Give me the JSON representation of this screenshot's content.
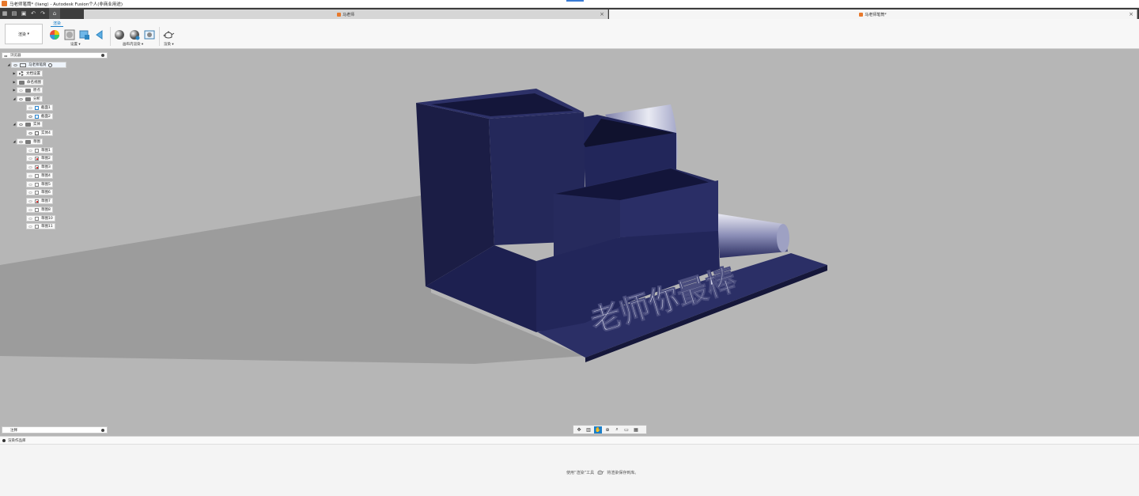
{
  "window": {
    "title": "马老师笔筒* (liang) - Autodesk Fusion个人(非商业用途)"
  },
  "tabs": [
    {
      "label": "马老师"
    },
    {
      "label": "马老师笔筒*"
    }
  ],
  "ribbon": {
    "workspace_label": "渲染",
    "tab_label": "渲染",
    "groups": {
      "setup": "设置",
      "incanvas": "画布内渲染",
      "render": "渲染"
    }
  },
  "browser": {
    "title": "浏览器",
    "root": "马老师笔筒",
    "items": [
      {
        "label": "文档设置",
        "depth": 1
      },
      {
        "label": "命名视图",
        "depth": 1
      },
      {
        "label": "原点",
        "depth": 1
      },
      {
        "label": "分析",
        "depth": 1
      },
      {
        "label": "截面1",
        "depth": 2
      },
      {
        "label": "截面2",
        "depth": 2
      },
      {
        "label": "实体",
        "depth": 1
      },
      {
        "label": "实体4",
        "depth": 2
      },
      {
        "label": "草图",
        "depth": 1
      },
      {
        "label": "草图1",
        "depth": 2
      },
      {
        "label": "草图2",
        "depth": 2
      },
      {
        "label": "草图3",
        "depth": 2
      },
      {
        "label": "草图4",
        "depth": 2
      },
      {
        "label": "草图5",
        "depth": 2
      },
      {
        "label": "草图6",
        "depth": 2
      },
      {
        "label": "草图7",
        "depth": 2
      },
      {
        "label": "草图8",
        "depth": 2
      },
      {
        "label": "草图10",
        "depth": 2
      },
      {
        "label": "草图11",
        "depth": 2
      }
    ]
  },
  "model": {
    "engraved_text": "老师你最棒"
  },
  "comments": {
    "title": "注释"
  },
  "gallery": {
    "title": "渲染作品库",
    "hint_before": "使用“渲染”工具",
    "hint_after": "将渲染保存到库。"
  },
  "colors": {
    "viewport": "#b6b6b6",
    "model": "#22265a",
    "accent": "#1a7fc9"
  }
}
